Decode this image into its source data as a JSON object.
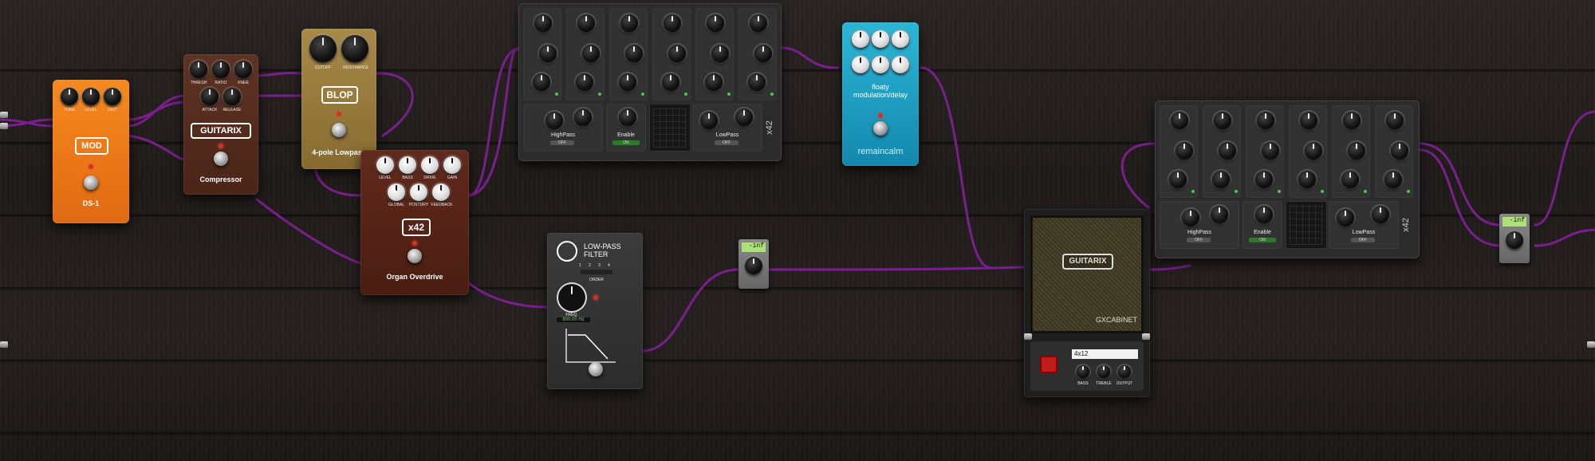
{
  "colors": {
    "cable": "#7a1f8c",
    "mod_pedal": "#f07a1a",
    "guitarix_pedal": "#5a2e1e",
    "blop_pedal": "#9a7a3c",
    "x42_pedal": "#5a2418",
    "floaty_pedal": "#1fa8c8",
    "lcd": "#aee07a"
  },
  "mod_pedal": {
    "knobs": [
      "TONE",
      "LEVEL",
      "DIST"
    ],
    "logo": "MOD",
    "name": "DS-1"
  },
  "guitarix_comp": {
    "knobs_top": [
      "THRESH",
      "RATIO",
      "KNEE"
    ],
    "knobs_bottom": [
      "ATTACK",
      "RELEASE"
    ],
    "logo": "GUITARIX",
    "name": "Compressor"
  },
  "blop": {
    "knobs": [
      "CUTOFF",
      "RESONANCE"
    ],
    "logo": "BLOP",
    "name": "4-pole Lowpass"
  },
  "organ": {
    "knobs_top": [
      "LEVEL",
      "BASS",
      "DRIVE",
      "GAIN"
    ],
    "knobs_bottom": [
      "GLOBAL",
      "POSTDRY",
      "FEEDBACK"
    ],
    "logo": "x42",
    "name": "Organ Overdrive"
  },
  "eq_top": {
    "brand": "x42",
    "sections": [
      "HighPass",
      "Enable",
      "LowPass"
    ],
    "switches": [
      "OFF",
      "ON",
      "OFF"
    ]
  },
  "eq_right": {
    "brand": "x42",
    "sections": [
      "HighPass",
      "Enable",
      "LowPass"
    ],
    "switches": [
      "OFF",
      "ON",
      "OFF"
    ]
  },
  "floaty": {
    "title": "floaty",
    "subtitle": "modulation/delay",
    "brand": "remaincalm"
  },
  "lpf": {
    "title_line1": "LOW-PASS",
    "title_line2": "FILTER",
    "order_label": "ORDER",
    "order_ticks": [
      "1",
      "2",
      "3",
      "4"
    ],
    "freq_label": "FREQ.",
    "freq_value": "600.00 Hz"
  },
  "meter_left": {
    "value": "-inf"
  },
  "meter_right": {
    "value": "-inf"
  },
  "cabinet": {
    "logo": "GUITARIX",
    "name": "GXCABINET",
    "model": "4x12",
    "knobs": [
      "BASS",
      "TREBLE",
      "OUTPUT"
    ]
  }
}
